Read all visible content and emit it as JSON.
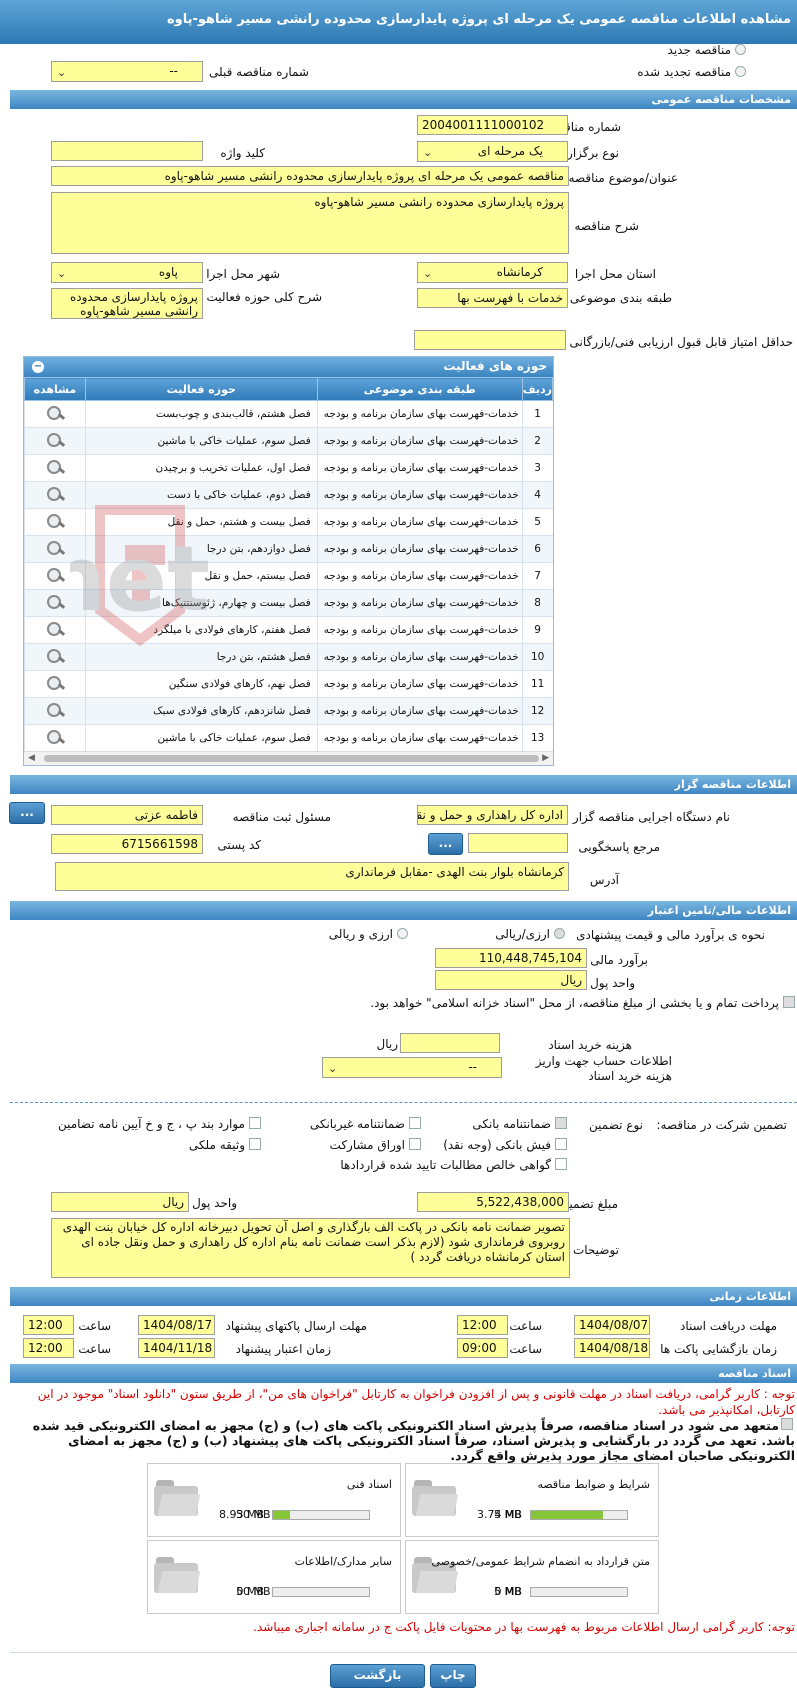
{
  "page_title": "مشاهده اطلاعات مناقصه عمومی یک مرحله ای پروژه پایدارسازی محدوده رانشی مسیر شاهو-پاوه",
  "tender_kind": {
    "new": "مناقصه جدید",
    "renewed": "مناقصه تجدید شده",
    "prev_label": "شماره مناقصه قبلی",
    "prev_value": "--"
  },
  "general": {
    "section": "مشخصات مناقصه عمومی",
    "number_label": "شماره مناقصه",
    "number": "2004001111000102",
    "type_label": "نوع برگزاری",
    "type": "یک مرحله ای",
    "keyword_label": "کلید واژه",
    "keyword": "",
    "subject_label": "عنوان/موضوع مناقصه",
    "subject": "مناقصه عمومی یک مرحله ای پروژه پایدارسازی محدوده رانشی مسیر شاهو-پاوه",
    "desc_label": "شرح مناقصه",
    "desc": "پروژه پایدارسازی محدوده رانشی مسیر شاهو-پاوه",
    "province_label": "استان محل اجرا",
    "province": "کرمانشاه",
    "city_label": "شهر محل اجرا",
    "city": "پاوه",
    "category_label": "طبقه بندی موضوعی",
    "category": "خدمات با فهرست بها",
    "scope_label": "شرح کلی حوزه فعالیت",
    "scope": "پروژه پایدارسازی محدوده رانشی مسیر شاهو-پاوه",
    "min_score_label": "حداقل امتیاز قابل قبول ارزیابی فنی/بازرگانی",
    "min_score": ""
  },
  "activities": {
    "title": "حوزه های فعالیت",
    "collapse_icon": "minus-circle-icon",
    "headers": [
      "ردیف",
      "طبقه بندی موضوعی",
      "حوزه فعالیت",
      "مشاهده"
    ],
    "rows": [
      {
        "n": "1",
        "cat": "خدمات-فهرست بهای سازمان برنامه و بودجه",
        "act": "فصل هشتم، قالب‌بندی و چوب‌بست"
      },
      {
        "n": "2",
        "cat": "خدمات-فهرست بهای سازمان برنامه و بودجه",
        "act": "فصل سوم، عملیات خاکی با ماشین"
      },
      {
        "n": "3",
        "cat": "خدمات-فهرست بهای سازمان برنامه و بودجه",
        "act": "فصل اول، عملیات تخریب و برچیدن"
      },
      {
        "n": "4",
        "cat": "خدمات-فهرست بهای سازمان برنامه و بودجه",
        "act": "فصل دوم، عملیات خاکی با دست"
      },
      {
        "n": "5",
        "cat": "خدمات-فهرست بهای سازمان برنامه و بودجه",
        "act": "فصل بیست و هشتم، حمل و نقل"
      },
      {
        "n": "6",
        "cat": "خدمات-فهرست بهای سازمان برنامه و بودجه",
        "act": "فصل دوازدهم، بتن درجا"
      },
      {
        "n": "7",
        "cat": "خدمات-فهرست بهای سازمان برنامه و بودجه",
        "act": "فصل بیستم، حمل و نقل"
      },
      {
        "n": "8",
        "cat": "خدمات-فهرست بهای سازمان برنامه و بودجه",
        "act": "فصل بیست و چهارم، ژئوسنتتیک‌ها"
      },
      {
        "n": "9",
        "cat": "خدمات-فهرست بهای سازمان برنامه و بودجه",
        "act": "فصل هفتم، کارهای فولادی با میلگرد"
      },
      {
        "n": "10",
        "cat": "خدمات-فهرست بهای سازمان برنامه و بودجه",
        "act": "فصل هشتم، بتن درجا"
      },
      {
        "n": "11",
        "cat": "خدمات-فهرست بهای سازمان برنامه و بودجه",
        "act": "فصل نهم، کارهای فولادی سنگین"
      },
      {
        "n": "12",
        "cat": "خدمات-فهرست بهای سازمان برنامه و بودجه",
        "act": "فصل شانزدهم، کارهای فولادی سبک"
      },
      {
        "n": "13",
        "cat": "خدمات-فهرست بهای سازمان برنامه و بودجه",
        "act": "فصل سوم، عملیات خاکی با ماشین"
      }
    ]
  },
  "organizer": {
    "section": "اطلاعات مناقصه گزار",
    "org_label": "نام دستگاه اجرایی مناقصه گزار",
    "org": "اداره کل راهداری و حمل و نقل جاده ای استان کرمانشاه",
    "resp_label": "مسئول ثبت مناقصه",
    "resp": "فاطمه  عزتی",
    "ref_label": "مرجع پاسخگویی",
    "ref": "",
    "postal_label": "کد پستی",
    "postal": "6715661598",
    "address_label": "آدرس",
    "address": "کرمانشاه بلوار بنت الهدی -مقابل فرمانداری",
    "dots": "..."
  },
  "finance": {
    "section": "اطلاعات مالی/تامین اعتبار",
    "estimate_label": "نحوه ی برآورد مالی و قیمت پیشنهادی",
    "opt1": "ارزی/ریالی",
    "opt2": "ارزی و ریالی",
    "estimate_amount_label": "برآورد مالی",
    "estimate_amount": "110,448,745,104",
    "currency_label": "واحد پول",
    "currency": "ریال",
    "treasury_text": "پرداخت تمام و یا بخشی از مبلغ مناقصه، از محل \"اسناد خزانه اسلامی\" خواهد بود.",
    "doc_fee_label": "هزینه خرید اسناد",
    "doc_fee": "",
    "doc_fee_unit": "ریال",
    "account_label": "اطلاعات حساب جهت واریز هزینه خرید اسناد",
    "account": "--"
  },
  "guarantee": {
    "label": "تضمین شرکت در مناقصه:",
    "type_label": "نوع تضمین",
    "options": [
      "ضمانتنامه بانکی",
      "ضمانتنامه غیربانکی",
      "موارد بند پ ، ج و خ آیین نامه تضامین",
      "فیش بانکی (وجه نقد)",
      "اوراق مشارکت",
      "وثیقه ملکی",
      "گواهی خالص مطالبات تایید شده قراردادها"
    ],
    "amount_label": "مبلغ تضمین",
    "amount": "5,522,438,000",
    "currency_label": "واحد پول",
    "currency": "ریال",
    "notes_label": "توضیحات",
    "notes": "تصویر ضمانت نامه بانکی در پاکت الف بارگذاری و اصل آن تحویل دبیرخانه اداره کل خیابان بنت الهدی روبروی فرمانداری شود  (لازم بذکر است ضمانت نامه بنام اداره کل راهداری و حمل ونقل جاده ای استان کرمانشاه دریافت گردد )"
  },
  "timing": {
    "section": "اطلاعات زمانی",
    "doc_deadline_label": "مهلت دریافت اسناد",
    "doc_deadline_date": "1404/08/07",
    "doc_deadline_time": "12:00",
    "submit_label": "مهلت ارسال پاکتهای پیشنهاد",
    "submit_date": "1404/08/17",
    "submit_time": "12:00",
    "open_label": "زمان بازگشایی پاکت ها",
    "open_date": "1404/08/18",
    "open_time": "09:00",
    "validity_label": "زمان اعتبار پیشنهاد",
    "validity_date": "1404/11/18",
    "validity_time": "12:00",
    "time_label": "ساعت"
  },
  "documents": {
    "section": "اسناد مناقصه",
    "notice": "توجه : کاربر گرامی، دریافت اسناد در مهلت قانونی و پس از افزودن فراخوان به کارتابل \"فراخوان های من\"، از طریق ستون \"دانلود اسناد\" موجود در این کارتابل، امکانپذیر می باشد.",
    "bold_note": "متعهد می شود در اسناد مناقصه، صرفاً پذیرش اسناد الکترونیکی پاکت های (ب) و (ج) مجهز به امضای الکترونیکی قید شده باشد. تعهد می گردد در بارگشایی و پذیرش اسناد، صرفاً اسناد الکترونیکی پاکت های پیشنهاد (ب) و (ج) مجهز به امضای الکترونیکی صاحبان امضای مجاز مورد پذیرش واقع گردد.",
    "files": [
      {
        "name": "شرایط و ضوابط مناقصه",
        "current": "3.74 MB",
        "max": "5 MB",
        "fill": 0.75
      },
      {
        "name": "اسناد فنی",
        "current": "8.93 MB",
        "max": "50 MB",
        "fill": 0.18
      },
      {
        "name": "متن قرارداد به انضمام شرایط عمومی/خصوصی",
        "current": "0 MB",
        "max": "5 MB",
        "fill": 0
      },
      {
        "name": "سایر مدارک/اطلاعات",
        "current": "0 MB",
        "max": "50 MB",
        "fill": 0
      }
    ],
    "bottom_notice": "توجه: کاربر گرامی ارسال اطلاعات مربوط به فهرست بها در محتویات فایل پاکت ج در سامانه اجباری میباشد."
  },
  "buttons": {
    "print": "چاپ",
    "back": "بازگشت"
  },
  "watermark": "ParsTender.net",
  "colors": {
    "header_blue": "#3d86c2",
    "field_yellow": "#ffff99",
    "red": "#d40000"
  }
}
